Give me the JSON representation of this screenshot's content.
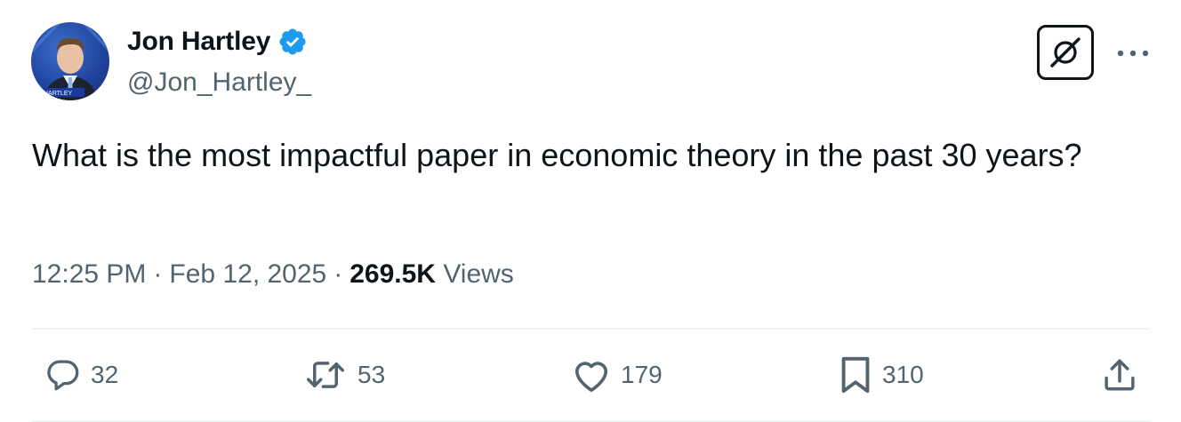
{
  "author": {
    "display_name": "Jon Hartley",
    "handle": "@Jon_Hartley_",
    "verified": true,
    "avatar_caption": "HARTLEY"
  },
  "tweet": {
    "text": "What is the most impactful paper in economic theory in the past 30 years?",
    "time": "12:25 PM",
    "date": "Feb 12, 2025",
    "views_count": "269.5K",
    "views_label": "Views"
  },
  "actions": {
    "replies": "32",
    "reposts": "53",
    "likes": "179",
    "bookmarks": "310"
  },
  "icons": {
    "verified": "verified-badge-icon",
    "grok": "grok-icon",
    "more": "more-icon",
    "reply": "reply-icon",
    "repost": "repost-icon",
    "like": "heart-icon",
    "bookmark": "bookmark-icon",
    "share": "share-icon"
  },
  "colors": {
    "text": "#0f1419",
    "secondary": "#536471",
    "verified": "#1d9bf0",
    "divider": "#eff3f4"
  }
}
